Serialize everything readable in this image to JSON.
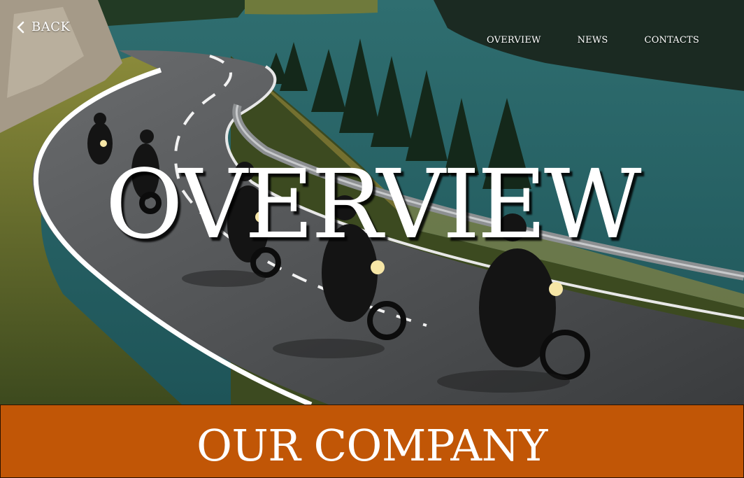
{
  "back": {
    "label": "BACK",
    "icon": "chevron-left-icon"
  },
  "nav": {
    "items": [
      {
        "label": "OVERVIEW"
      },
      {
        "label": "NEWS"
      },
      {
        "label": "CONTACTS"
      }
    ]
  },
  "hero": {
    "title": "OVERVIEW",
    "image_subject": "motorcycle-riders-mountain-lake-road"
  },
  "section": {
    "heading": "OUR COMPANY",
    "background_color": "#c15606"
  }
}
